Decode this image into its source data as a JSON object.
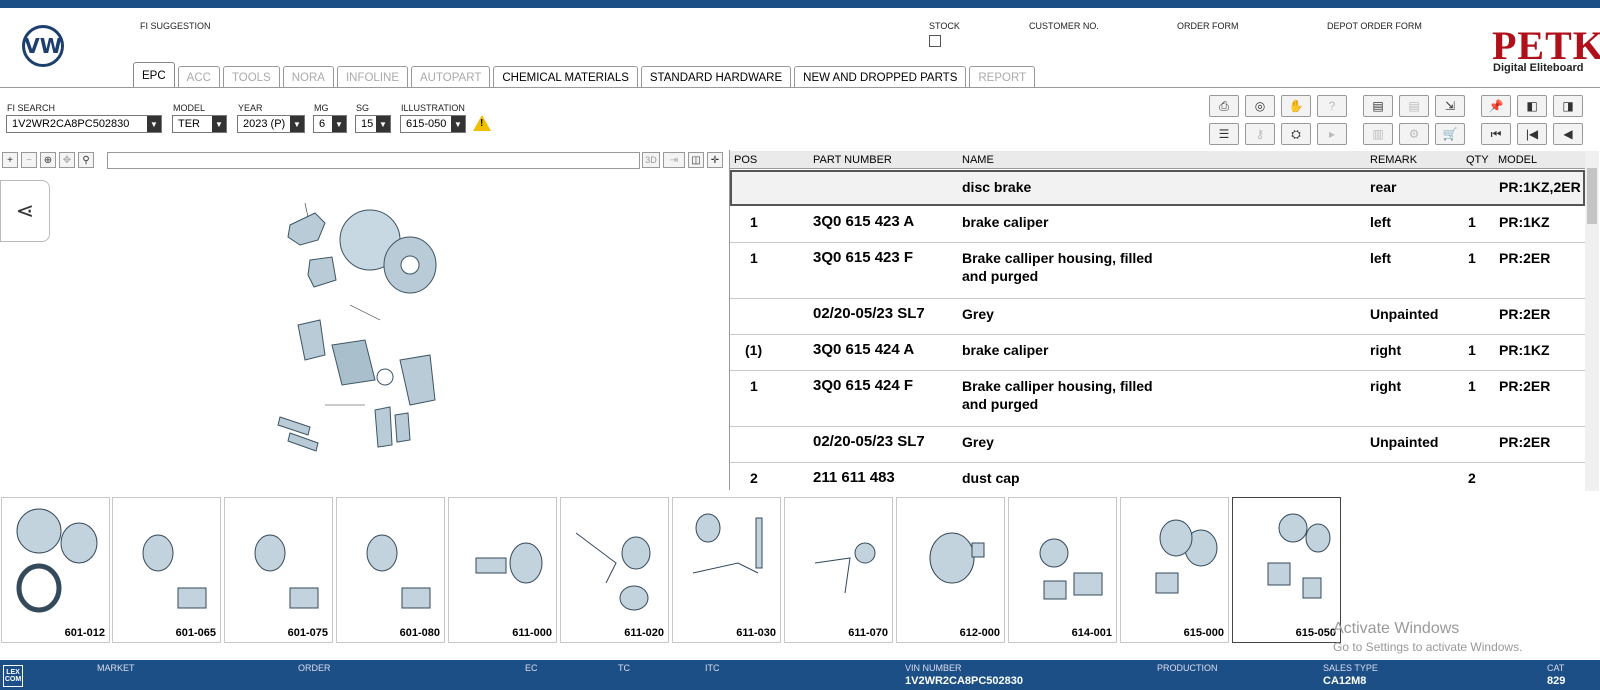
{
  "header": {
    "fi_suggestion_label": "FI SUGGESTION",
    "stock_label": "STOCK",
    "customer_no_label": "CUSTOMER NO.",
    "order_form_label": "ORDER FORM",
    "depot_order_form_label": "DEPOT ORDER FORM",
    "brand_logo_text": "VW",
    "petka_title": "PETKA",
    "petka_subtitle": "Digital Eliteboard"
  },
  "tabs": [
    {
      "label": "EPC",
      "active": true,
      "disabled": false
    },
    {
      "label": "ACC",
      "active": false,
      "disabled": true
    },
    {
      "label": "TOOLS",
      "active": false,
      "disabled": true
    },
    {
      "label": "NORA",
      "active": false,
      "disabled": true
    },
    {
      "label": "INFOLINE",
      "active": false,
      "disabled": true
    },
    {
      "label": "AUTOPART",
      "active": false,
      "disabled": true
    },
    {
      "label": "CHEMICAL MATERIALS",
      "active": false,
      "disabled": false
    },
    {
      "label": "STANDARD HARDWARE",
      "active": false,
      "disabled": false
    },
    {
      "label": "NEW AND DROPPED PARTS",
      "active": false,
      "disabled": false
    },
    {
      "label": "REPORT",
      "active": false,
      "disabled": true
    }
  ],
  "filters": {
    "fi_search_label": "FI SEARCH",
    "fi_search_value": "1V2WR2CA8PC502830",
    "model_label": "MODEL",
    "model_value": "TER",
    "year_label": "YEAR",
    "year_value": "2023 (P)",
    "mg_label": "MG",
    "mg_value": "6",
    "sg_label": "SG",
    "sg_value": "15",
    "illustration_label": "ILLUSTRATION",
    "illustration_value": "615-050"
  },
  "table": {
    "headers": {
      "pos": "POS",
      "part_number": "PART NUMBER",
      "name": "NAME",
      "remark": "REMARK",
      "qty": "QTY",
      "model": "MODEL"
    },
    "rows": [
      {
        "pos": "",
        "part_number": "",
        "name": "disc brake",
        "name2": "",
        "remark": "rear",
        "qty": "",
        "model": "PR:1KZ,2ER"
      },
      {
        "pos": "1",
        "part_number": "3Q0 615 423 A",
        "name": "brake caliper",
        "name2": "",
        "remark": "left",
        "qty": "1",
        "model": "PR:1KZ"
      },
      {
        "pos": "1",
        "part_number": "3Q0 615 423 F",
        "name": "Brake calliper housing, filled",
        "name2": "and purged",
        "remark": "left",
        "qty": "1",
        "model": "PR:2ER"
      },
      {
        "pos": "",
        "part_number": "02/20-05/23 SL7",
        "name": "Grey",
        "name2": "",
        "remark": "Unpainted",
        "qty": "",
        "model": "PR:2ER"
      },
      {
        "pos": "(1)",
        "part_number": "3Q0 615 424 A",
        "name": "brake caliper",
        "name2": "",
        "remark": "right",
        "qty": "1",
        "model": "PR:1KZ"
      },
      {
        "pos": "1",
        "part_number": "3Q0 615 424 F",
        "name": "Brake calliper housing, filled",
        "name2": "and purged",
        "remark": "right",
        "qty": "1",
        "model": "PR:2ER"
      },
      {
        "pos": "",
        "part_number": "02/20-05/23 SL7",
        "name": "Grey",
        "name2": "",
        "remark": "Unpainted",
        "qty": "",
        "model": "PR:2ER"
      },
      {
        "pos": "2",
        "part_number": "211 611 483",
        "name": "dust cap",
        "name2": "",
        "remark": "",
        "qty": "2",
        "model": ""
      }
    ]
  },
  "viewer_tools": {
    "three_d": "3D"
  },
  "thumbnails": [
    "601-012",
    "601-065",
    "601-075",
    "601-080",
    "611-000",
    "611-020",
    "611-030",
    "611-070",
    "612-000",
    "614-001",
    "615-000",
    "615-050"
  ],
  "watermark": {
    "line1": "Activate Windows",
    "line2": "Go to Settings to activate Windows."
  },
  "status_bar": {
    "logo": "LEX COM",
    "market_label": "MARKET",
    "order_label": "ORDER",
    "ec_label": "EC",
    "tc_label": "TC",
    "itc_label": "ITC",
    "vin_label": "VIN NUMBER",
    "vin_value": "1V2WR2CA8PC502830",
    "production_label": "PRODUCTION",
    "sales_type_label": "SALES TYPE",
    "sales_type_value": "CA12M8",
    "cat_label": "CAT",
    "cat_value": "829"
  },
  "colors": {
    "brand_blue": "#1c4f86",
    "petka_red": "#b0101a",
    "warning_yellow": "#f0c000"
  }
}
